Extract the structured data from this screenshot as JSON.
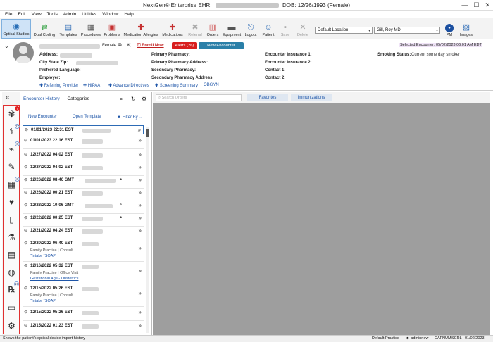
{
  "window": {
    "app": "NextGen® Enterprise EHR:",
    "dob_text": "DOB: 12/26/1993",
    "sex_text": "(Female)"
  },
  "menu": [
    "File",
    "Edit",
    "View",
    "Tools",
    "Admin",
    "Utilities",
    "Window",
    "Help"
  ],
  "toolbar": {
    "buttons": [
      {
        "label": "Optical Studies",
        "icon": "eye-icon"
      },
      {
        "label": "Dual Coding",
        "icon": "arrows-icon"
      },
      {
        "label": "Templates",
        "icon": "templates-icon"
      },
      {
        "label": "Procedures",
        "icon": "procedures-icon"
      },
      {
        "label": "Problems",
        "icon": "problems-icon"
      },
      {
        "label": "Medication Allergies",
        "icon": "allergy-icon"
      },
      {
        "label": "Medications",
        "icon": "pills-icon"
      },
      {
        "label": "Referral",
        "icon": "referral-icon"
      },
      {
        "label": "Orders",
        "icon": "orders-icon"
      },
      {
        "label": "Equipment",
        "icon": "equipment-icon"
      },
      {
        "label": "Logout",
        "icon": "logout-icon"
      },
      {
        "label": "Patient",
        "icon": "patient-icon"
      },
      {
        "label": "Save",
        "icon": "save-icon"
      },
      {
        "label": "Delete",
        "icon": "delete-icon"
      },
      {
        "label": "PM",
        "icon": "pm-icon"
      },
      {
        "label": "Images",
        "icon": "images-icon"
      }
    ],
    "location": "Default Location",
    "provider": "Gill, Roy MD"
  },
  "patient": {
    "sex": "Female",
    "enroll": "Enroll Now",
    "alerts": "Alerts (26)",
    "new_encounter": "New Encounter",
    "selected_encounter": "Selected Encounter: 05/02/2023 06:01 AM EDT",
    "labels": {
      "address": "Address:",
      "city": "City State Zip:",
      "language": "Preferred Language:",
      "employer": "Employer:",
      "primary_pharmacy": "Primary Pharmacy:",
      "primary_pharmacy_address": "Primary Pharmacy Address:",
      "secondary_pharmacy": "Secondary Pharmacy:",
      "secondary_pharmacy_address": "Secondary Pharmacy Address:",
      "insurance1": "Encounter Insurance 1:",
      "insurance2": "Encounter Insurance 2:",
      "contact1": "Contact 1:",
      "contact2": "Contact 2:",
      "smoking": "Smoking Status:"
    },
    "smoking_value": "Current some day smoker",
    "links": [
      "Referring Provider",
      "HIPAA",
      "Advance Directives",
      "Screening Summary",
      "OBGYN"
    ]
  },
  "encounters": {
    "tabs": [
      "Encounter History",
      "Categories"
    ],
    "new_encounter": "New Encounter",
    "open_template": "Open Template",
    "filter_by": "Filter By",
    "rows": [
      {
        "date": "01/01/2023 22:31 EST",
        "lock": false,
        "sub": "",
        "links": []
      },
      {
        "date": "01/01/2023 22:16 EST",
        "lock": false,
        "sub": "",
        "links": []
      },
      {
        "date": "12/27/2022 04:02 EST",
        "lock": false,
        "sub": "",
        "links": []
      },
      {
        "date": "12/27/2022 04:02 EST",
        "lock": false,
        "sub": "",
        "links": []
      },
      {
        "date": "12/26/2022 08:46 GMT",
        "lock": true,
        "sub": "",
        "links": []
      },
      {
        "date": "12/26/2022 00:21 EST",
        "lock": false,
        "sub": "",
        "links": []
      },
      {
        "date": "12/23/2022 10:06 GMT",
        "lock": true,
        "sub": "",
        "links": []
      },
      {
        "date": "12/22/2022 00:25 EST",
        "lock": true,
        "sub": "",
        "links": []
      },
      {
        "date": "12/21/2022 04:24 EST",
        "lock": false,
        "sub": "",
        "links": []
      },
      {
        "date": "12/20/2022 06:40 EST",
        "lock": false,
        "sub": "Family Practice | Consult",
        "links": [
          "*Intake *SOAP"
        ]
      },
      {
        "date": "12/16/2022 05:32 EST",
        "lock": false,
        "sub": "Family Practice | Office Visit",
        "links": [
          "Gestational Age - Obstetrics"
        ]
      },
      {
        "date": "12/15/2022 05:26 EST",
        "lock": false,
        "sub": "Family Practice | Consult",
        "links": [
          "*Intake *SOAP"
        ]
      },
      {
        "date": "12/15/2022 05:26 EST",
        "lock": false,
        "sub": "",
        "links": []
      },
      {
        "date": "12/15/2022 01:23 EST",
        "lock": false,
        "sub": "",
        "links": []
      }
    ]
  },
  "sidebar": {
    "badges": {
      "first": "7",
      "second": "27",
      "third": "6",
      "fourth": "6",
      "last": "19"
    }
  },
  "main": {
    "search_placeholder": "Search Orders",
    "favorites": "Favorites",
    "immunizations": "Immunizations"
  },
  "status": {
    "message": "Shows the patient's optical device import history",
    "practice": "Default Practice",
    "user": "adminnew",
    "cap": "CAP",
    "num": "NUM",
    "scrl": "SCRL",
    "date": "01/02/2023"
  }
}
